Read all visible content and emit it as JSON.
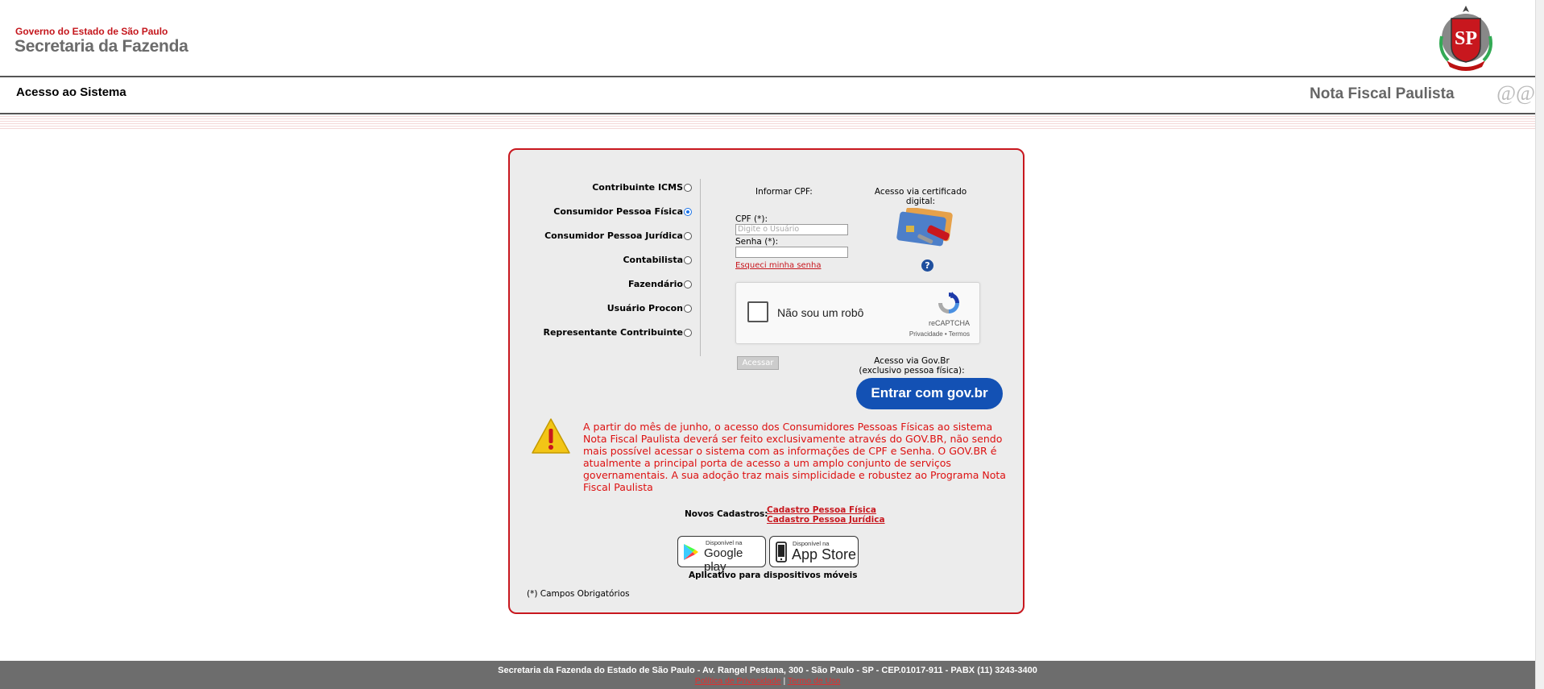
{
  "header": {
    "gov_line": "Governo do Estado de São Paulo",
    "secretaria": "Secretaria da Fazenda",
    "brasao_text": "SP",
    "page_title": "Acesso ao Sistema",
    "system_name": "Nota Fiscal Paulista",
    "at_logo": "@@"
  },
  "login": {
    "radio_options": [
      {
        "label": "Contribuinte ICMS",
        "checked": false
      },
      {
        "label": "Consumidor Pessoa Física",
        "checked": true
      },
      {
        "label": "Consumidor Pessoa Jurídica",
        "checked": false
      },
      {
        "label": "Contabilista",
        "checked": false
      },
      {
        "label": "Fazendário",
        "checked": false
      },
      {
        "label": "Usuário Procon",
        "checked": false
      },
      {
        "label": "Representante Contribuinte",
        "checked": false
      }
    ],
    "informar_label": "Informar CPF:",
    "cpf_label": "CPF (*):",
    "cpf_placeholder": "Digite o Usuário",
    "senha_label": "Senha (*):",
    "forgot_link": "Esqueci minha senha",
    "certificado_label": "Acesso via certificado digital:",
    "captcha_text": "Não sou um robô",
    "captcha_brand": "reCAPTCHA",
    "captcha_links": "Privacidade • Termos",
    "acessar_button": "Acessar",
    "govbr_label_1": "Acesso via Gov.Br",
    "govbr_label_2": "(exclusivo pessoa física):",
    "govbr_button_prefix": "Entrar com",
    "govbr_button_brand": "gov.br",
    "warning_text": "A partir do mês de junho, o acesso dos Consumidores Pessoas Físicas ao sistema Nota Fiscal Paulista deverá ser feito exclusivamente através do GOV.BR, não sendo mais possível acessar o sistema com as informações de CPF e Senha. O GOV.BR é atualmente a principal porta de acesso a um amplo conjunto de serviços governamentais. A sua adoção traz mais simplicidade e robustez ao Programa Nota Fiscal Paulista",
    "novos_cadastros_label": "Novos Cadastros:",
    "cadastro_pf": "Cadastro Pessoa Física",
    "cadastro_pj": "Cadastro Pessoa Jurídica",
    "google_small": "Disponível na",
    "google_big": "Google play",
    "apple_small": "Disponível na",
    "apple_big": "App Store",
    "apps_caption": "Aplicativo para dispositivos móveis",
    "required_note": "(*) Campos Obrigatórios"
  },
  "footer": {
    "address": "Secretaria da Fazenda do Estado de São Paulo - Av. Rangel Pestana, 300 - São Paulo - SP - CEP.01017-911 - PABX (11) 3243-3400",
    "privacy_link": "Política de Privacidade",
    "separator": "|",
    "terms_link": "Termo de Uso"
  },
  "colors": {
    "brand_red": "#c8171e",
    "govbr_blue": "#1351b4",
    "footer_gray": "#6d6d6d",
    "panel_bg": "#ececec"
  }
}
